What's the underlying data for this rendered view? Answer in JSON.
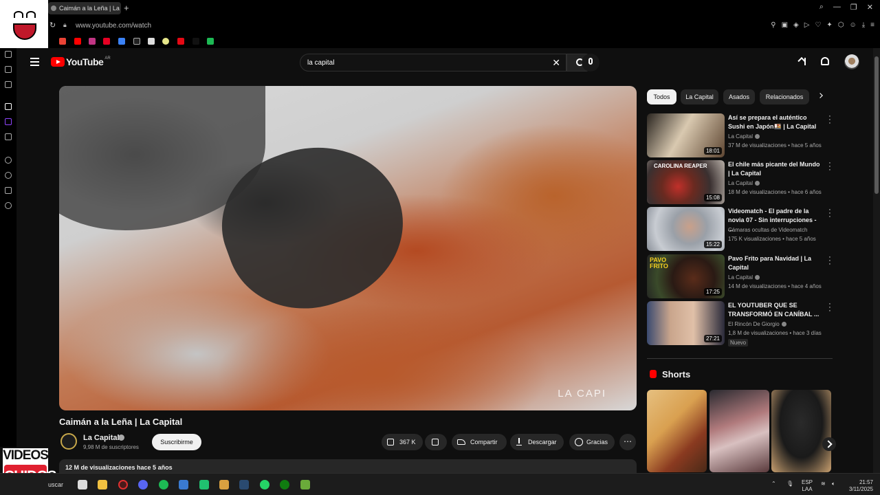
{
  "browser": {
    "tab_title": "Caimán a la Leña | La",
    "url": "www.youtube.com/watch"
  },
  "header": {
    "logo_text": "YouTube",
    "country": "AR",
    "search_value": "la capital"
  },
  "video": {
    "title": "Caimán a la Leña | La Capital",
    "watermark": "LA CAPI",
    "channel": "La Capital",
    "subscribers": "9,98 M de suscriptores",
    "subscribe_label": "Suscribirme",
    "likes": "367 K",
    "share_label": "Compartir",
    "download_label": "Descargar",
    "thanks_label": "Gracias",
    "more_label": "⋯",
    "desc_meta": "12 M de visualizaciones  hace 5 años"
  },
  "chips": [
    "Todos",
    "La Capital",
    "Asados",
    "Relacionados"
  ],
  "recommendations": [
    {
      "title": "Así se prepara el auténtico Sushi en Japón🍱 | La Capital",
      "channel": "La Capital",
      "meta": "37 M de visualizaciones • hace 5 años",
      "duration": "18:01",
      "thumb_color": "#6b5a44"
    },
    {
      "title": "El chile más picante del Mundo | La Capital",
      "channel": "La Capital",
      "meta": "18 M de visualizaciones • hace 6 años",
      "duration": "15:08",
      "thumb_color": "#4a2a24",
      "thumb_text": "CAROLINA REAPER"
    },
    {
      "title": "Videomatch - El padre de la novia 07 - Sin interrupciones - ...",
      "channel": "Cámaras ocultas de Videomatch",
      "meta": "175 K visualizaciones • hace 5 años",
      "duration": "15:22",
      "thumb_color": "#8a8f96"
    },
    {
      "title": "Pavo Frito para Navidad | La Capital",
      "channel": "La Capital",
      "meta": "14 M de visualizaciones • hace 4 años",
      "duration": "17:25",
      "thumb_color": "#3a2a20",
      "thumb_text": "PAVO FRITO"
    },
    {
      "title": "EL YOUTUBER QUE SE TRANSFORMÓ EN CANÍBAL ...",
      "channel": "El Rincón De Giorgio",
      "meta": "1,8 M de visualizaciones • hace 3 días",
      "duration": "27:21",
      "thumb_color": "#c9a58c",
      "badge": "Nuevo"
    }
  ],
  "shorts": {
    "label": "Shorts",
    "items": [
      {
        "color_a": "#d9b16a",
        "color_b": "#7a2f1a"
      },
      {
        "color_a": "#b57a78",
        "color_b": "#5c3a3c"
      },
      {
        "color_a": "#3a3a3a",
        "color_b": "#b89a70"
      }
    ]
  },
  "taskbar": {
    "search_label": "uscar",
    "lang_top": "ESP",
    "lang_bottom": "LAA",
    "time": "21:57",
    "date": "3/11/2025"
  },
  "overlay": {
    "logo_line1": "VIDEOS",
    "logo_line2": "CHIDOS"
  }
}
